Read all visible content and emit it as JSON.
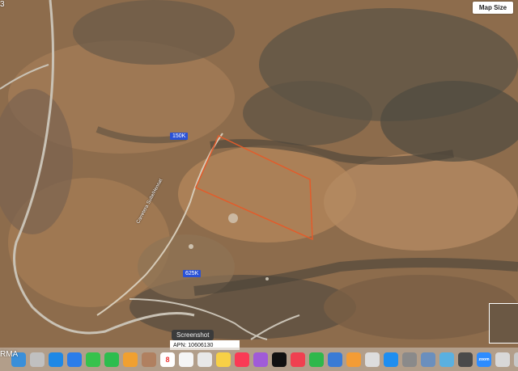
{
  "map": {
    "corner_text_top": "3",
    "corner_text_bottom": "RMA",
    "map_size_label": "Map Size",
    "price_badges": [
      "150K",
      "625K"
    ],
    "road_label_main": "Carretera Suite/Hennat",
    "apn_label": "APN: 10606130",
    "tooltip": "Screenshot",
    "parcel_color": "#e35b2a"
  },
  "dock": {
    "icons": [
      {
        "name": "finder-icon",
        "color": "#3a8fd9"
      },
      {
        "name": "launchpad-icon",
        "color": "#c0c0c0"
      },
      {
        "name": "safari-icon",
        "color": "#1e88e5"
      },
      {
        "name": "mail-icon",
        "color": "#2b7de9"
      },
      {
        "name": "messages-icon",
        "color": "#37c24c"
      },
      {
        "name": "facetime-icon",
        "color": "#2dbd4e"
      },
      {
        "name": "photos-icon",
        "color": "#f0a030"
      },
      {
        "name": "contacts-icon",
        "color": "#b08060"
      },
      {
        "name": "calendar-icon",
        "color": "#ffffff"
      },
      {
        "name": "reminders-icon",
        "color": "#f5f5f5"
      },
      {
        "name": "screenshot-icon",
        "color": "#e8e8e8"
      },
      {
        "name": "notes-icon",
        "color": "#f7d046"
      },
      {
        "name": "music-icon",
        "color": "#fa3a55"
      },
      {
        "name": "podcasts-icon",
        "color": "#a05bd8"
      },
      {
        "name": "tv-icon",
        "color": "#111111"
      },
      {
        "name": "news-icon",
        "color": "#f04050"
      },
      {
        "name": "numbers-icon",
        "color": "#2eb84b"
      },
      {
        "name": "keynote-icon",
        "color": "#3a7bd5"
      },
      {
        "name": "pages-icon",
        "color": "#f39c35"
      },
      {
        "name": "chrome-icon",
        "color": "#dddddd"
      },
      {
        "name": "appstore-icon",
        "color": "#1e8ef0"
      },
      {
        "name": "settings-icon",
        "color": "#8a8a8a"
      },
      {
        "name": "preview-icon",
        "color": "#6b8fbd"
      },
      {
        "name": "notability-icon",
        "color": "#5ab0e0"
      },
      {
        "name": "monitor-icon",
        "color": "#4a4a4a"
      },
      {
        "name": "zoom-icon",
        "color": "#2d8cff"
      },
      {
        "name": "downloads-icon",
        "color": "#d8d8d8"
      },
      {
        "name": "trash-icon",
        "color": "#c8c8c8"
      }
    ],
    "calendar_day": "8",
    "zoom_label": "zoom"
  }
}
